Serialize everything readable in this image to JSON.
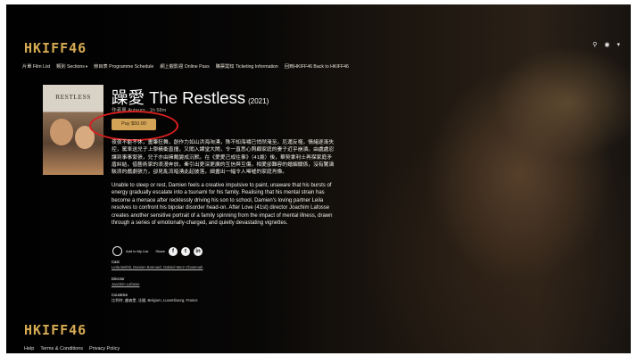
{
  "logo": "HKIFF46",
  "nav": [
    {
      "label": "片單 Film List"
    },
    {
      "label": "類別 Sections",
      "dropdown": true
    },
    {
      "label": "節目表 Programme Schedule"
    },
    {
      "label": "網上觀影證 Online Pass"
    },
    {
      "label": "購票需知 Ticketing Information"
    },
    {
      "label": "回到HKIFF46 Back to HKIFF46"
    }
  ],
  "header_icons": {
    "search": "search-icon",
    "account": "user-icon",
    "caret": "▾"
  },
  "film": {
    "title": "躁愛 The Restless",
    "year": "(2021)",
    "meta": "作者風 Auteurs · 1h 58m",
    "pay_label": "Pay $50.00",
    "poster_title": "RESTLESS",
    "synopsis_zh": "夜夜不能不休，畫筆狂舞，創作力如山洪海洶湧，殊不知海嘯已悄然淹至。厄運反噬，情緒逐漸失控，駕車送兒子上學橫衝直撞，又闖入課堂大鬧，令一直悉心照顧家庭的妻子近乎崩潰。由處處忍讓到事事緊張，兒子亦由擁戴變成沉默。在《愛愛己成往事》（41歲）後，華契拿利士再探家庭矛盾糾結，借藝術家的浪漫奔放，牽引出更深更廣的互信與互傷，相愛卻難容的婚姻關係，沒有驚濤駭浪的戲劇張力，卻見亂流暗湧此起彼落，細畫出一幅令人唏噓的家庭肖像。",
    "synopsis_en": "Unable to sleep or rest, Damien feels a creative impulsive to paint, unaware that his bursts of energy gradually escalate into a tsunami for his family. Realising that his mental strain has become a menace after recklessly driving his son to school, Damien's loving partner Leila resolves to confront his bipolar disorder head-on. After Love (41st) director Joachim Lafosse creates another sensitive portrait of a family spinning from the impact of mental illness, drawn through a series of emotionally-charged, and quietly devastating vignettes.",
    "add_label": "Add to My List",
    "share_label": "Share",
    "social": [
      "f",
      "t",
      "in"
    ],
    "cast_label": "Cast",
    "cast": "Leïla Bekhti, Damien Bonnard, Gabriel Merz Chammah",
    "director_label": "Director",
    "director": "Joachim Lafosse",
    "countries_label": "Countries",
    "countries": "比利時, 盧森堡, 法國, Belgium, Luxembourg, France"
  },
  "footer": {
    "links": [
      "Help",
      "Terms & Conditions",
      "Privacy Policy"
    ]
  },
  "colors": {
    "accent": "#d3a458",
    "annotation": "#d81f1f"
  }
}
